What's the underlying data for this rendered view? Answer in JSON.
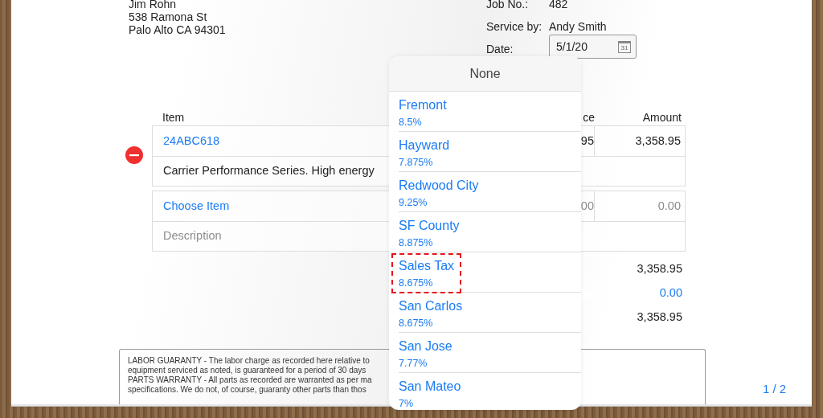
{
  "customer": {
    "lines": [
      "Jim Rohn",
      "538 Ramona St",
      "Palo Alto CA 94301"
    ]
  },
  "job": {
    "fields": [
      {
        "label": "Job No.:",
        "value": "482"
      },
      {
        "label": "Service by:",
        "value": "Andy Smith"
      }
    ],
    "date_label": "Date:",
    "date_value": "5/1/20",
    "date_icon_label": "31"
  },
  "table": {
    "columns": [
      "Item",
      "ce",
      "Amount"
    ],
    "groups": [
      {
        "kind": "entry",
        "removable": true,
        "item": "24ABC618",
        "price": "95",
        "amount": "3,358.95",
        "description": "Carrier Performance Series. High energy"
      },
      {
        "kind": "empty",
        "removable": false,
        "item": "Choose Item",
        "price": "00",
        "amount": "0.00",
        "placeholder": "Description"
      }
    ]
  },
  "totals": [
    {
      "kind": "plain",
      "value": "3,358.95"
    },
    {
      "kind": "link",
      "value": "0.00"
    },
    {
      "kind": "plain",
      "value": "3,358.95"
    }
  ],
  "warranty": {
    "lines": [
      "LABOR GUARANTY - The labor charge as recorded here relative to",
      "equipment serviced as noted, is guaranteed for a period of 30 days",
      "PARTS WARRANTY - All parts as recorded are warranted as per ma",
      "specifications. We do not, of course, guaranty other parts than thos"
    ]
  },
  "pager": "1 / 2",
  "popover": {
    "header": "None",
    "options": [
      {
        "name": "Fremont",
        "rate": "8.5%",
        "selected": false
      },
      {
        "name": "Hayward",
        "rate": "7.875%",
        "selected": false
      },
      {
        "name": "Redwood City",
        "rate": "9.25%",
        "selected": false
      },
      {
        "name": "SF County",
        "rate": "8.875%",
        "selected": false
      },
      {
        "name": "Sales Tax",
        "rate": "8.675%",
        "selected": true
      },
      {
        "name": "San Carlos",
        "rate": "8.675%",
        "selected": false
      },
      {
        "name": "San Jose",
        "rate": "7.77%",
        "selected": false
      },
      {
        "name": "San Mateo",
        "rate": "7%",
        "selected": false
      }
    ]
  }
}
